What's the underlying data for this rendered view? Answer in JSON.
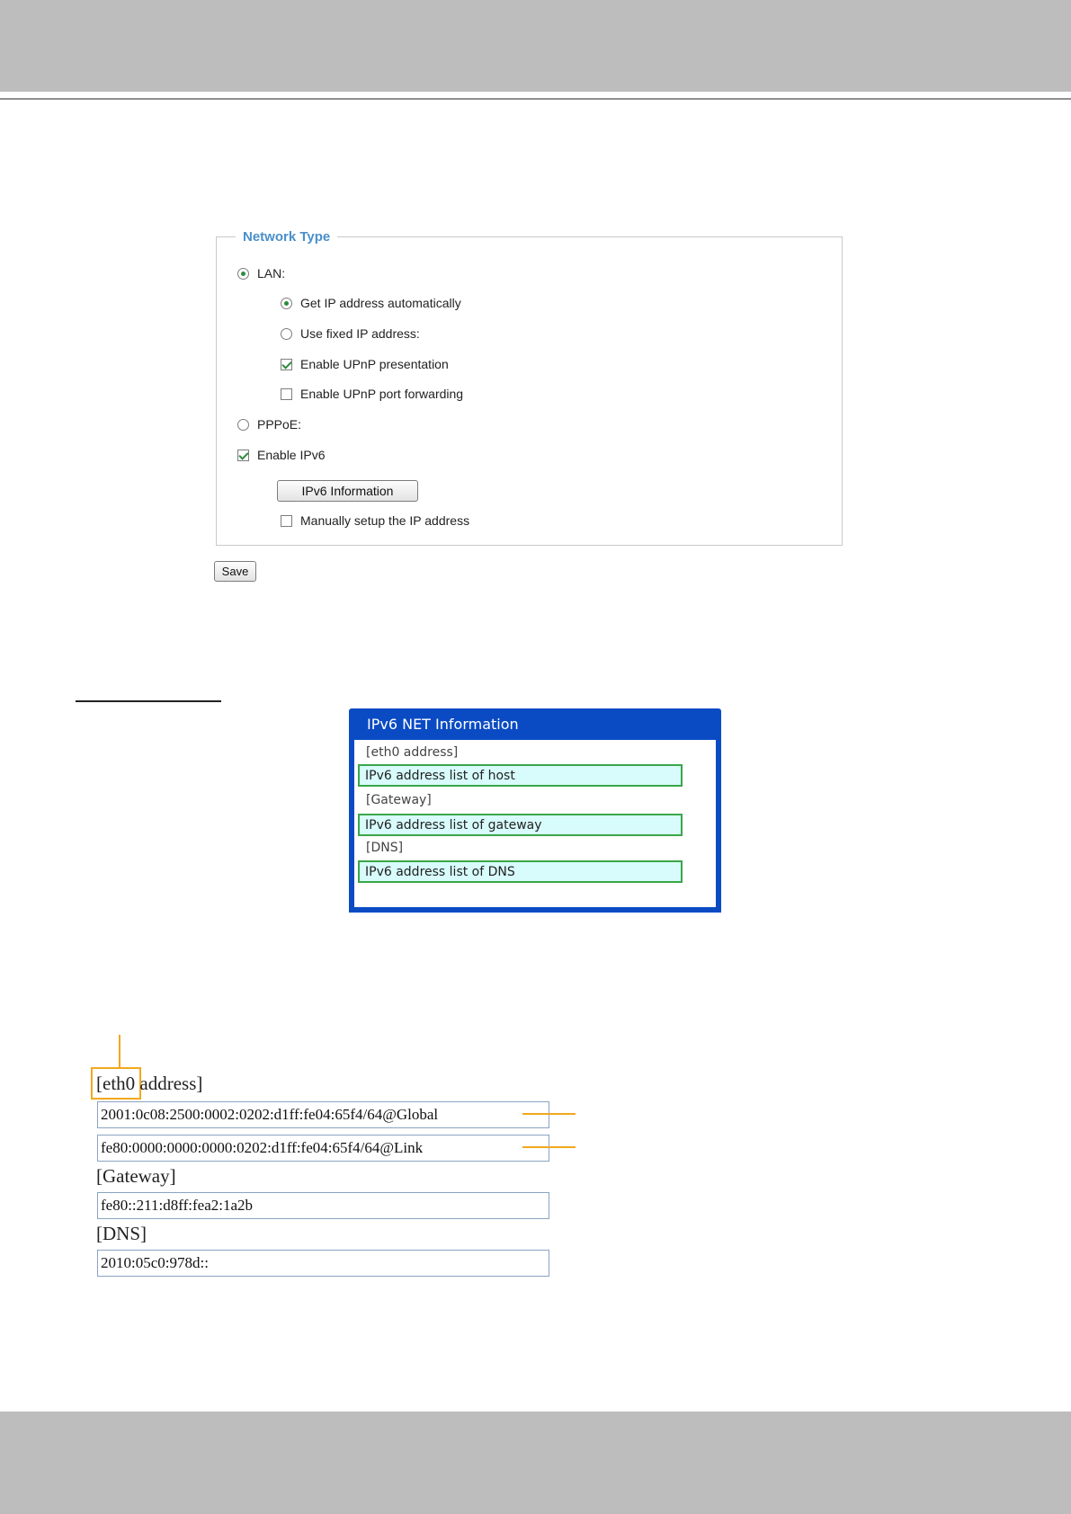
{
  "network_type": {
    "legend": "Network Type",
    "lan_label": "LAN:",
    "get_ip_auto": "Get IP address automatically",
    "use_fixed_ip": "Use fixed IP address:",
    "enable_upnp_presentation": "Enable UPnP presentation",
    "enable_upnp_port_forwarding": "Enable UPnP port forwarding",
    "pppoe_label": "PPPoE:",
    "enable_ipv6": "Enable IPv6",
    "ipv6_info_button": "IPv6 Information",
    "manual_setup": "Manually setup the IP address",
    "selected": "LAN",
    "lan_mode": "Get IP address automatically",
    "upnp_presentation_checked": true,
    "upnp_port_forwarding_checked": false,
    "ipv6_checked": true,
    "manual_setup_checked": false
  },
  "save_button": "Save",
  "ipv6_window": {
    "title": "IPv6 NET Information",
    "eth0_label": "[eth0 address]",
    "eth0_value": "IPv6 address list of host",
    "gateway_label": "[Gateway]",
    "gateway_value": "IPv6 address list of gateway",
    "dns_label": "[DNS]",
    "dns_value": "IPv6 address list of DNS"
  },
  "sample": {
    "eth0_label_prefix": "[",
    "eth0_label_iface": "eth0",
    "eth0_label_suffix": " address]",
    "eth0_global": "2001:0c08:2500:0002:0202:d1ff:fe04:65f4/64@Global",
    "eth0_link": "fe80:0000:0000:0000:0202:d1ff:fe04:65f4/64@Link",
    "gateway_label": "[Gateway]",
    "gateway_value": "fe80::211:d8ff:fea2:1a2b",
    "dns_label": "[DNS]",
    "dns_value": "2010:05c0:978d::"
  },
  "colors": {
    "accent_orange": "#f2a81d",
    "window_blue": "#0a4bc4",
    "legend_blue": "#4a8fcb"
  }
}
